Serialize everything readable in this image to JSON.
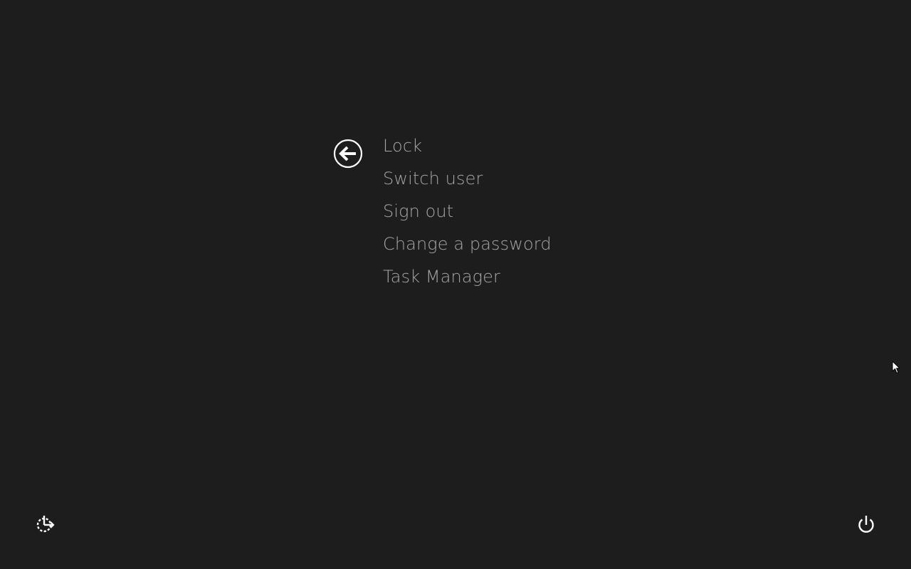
{
  "menu": {
    "items": [
      {
        "label": "Lock"
      },
      {
        "label": "Switch user"
      },
      {
        "label": "Sign out"
      },
      {
        "label": "Change a password"
      },
      {
        "label": "Task Manager"
      }
    ]
  },
  "icons": {
    "back": "back-arrow-circle-icon",
    "ease_of_access": "ease-of-access-icon",
    "power": "power-icon",
    "cursor": "mouse-pointer-icon"
  },
  "colors": {
    "background": "#1d1d1d",
    "menu_text": "#a5a5a5",
    "icon": "#ffffff"
  }
}
